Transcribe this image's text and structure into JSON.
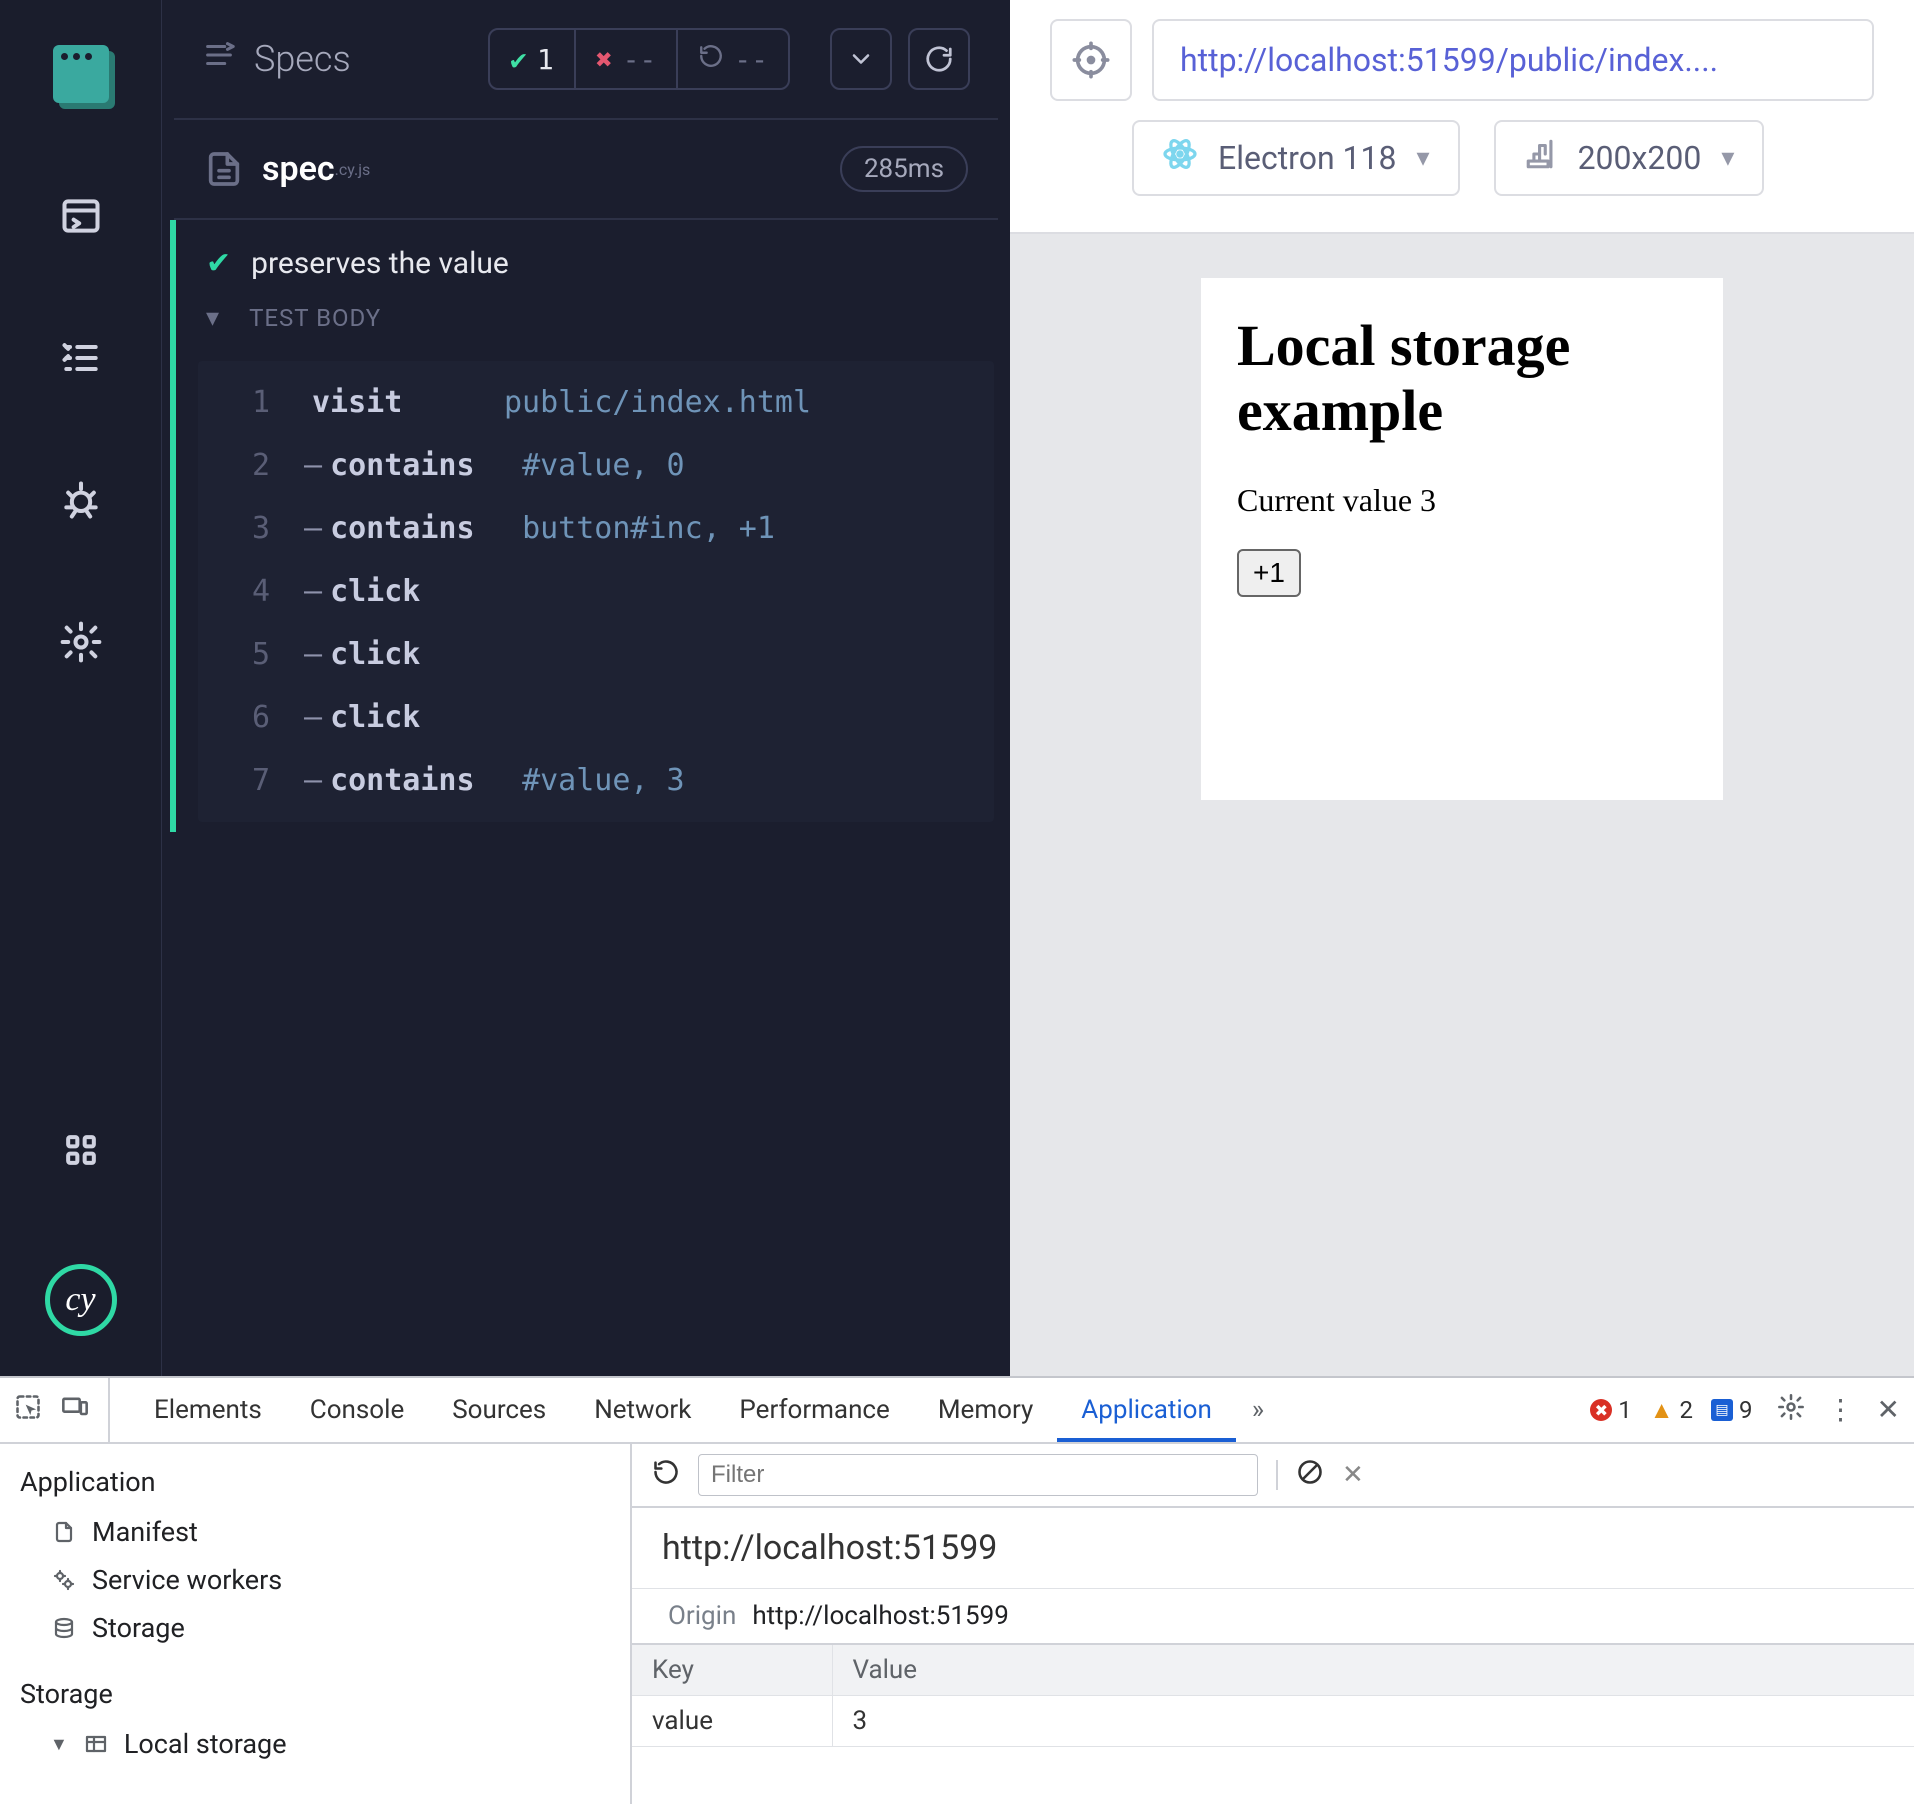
{
  "rail": {},
  "specsHeader": {
    "title": "Specs",
    "pass": "1",
    "fail": "--",
    "pending": "--"
  },
  "specFile": {
    "name": "spec",
    "ext": ".cy.js",
    "time": "285ms"
  },
  "test": {
    "title": "preserves the value",
    "bodyLabel": "TEST BODY",
    "commands": [
      {
        "n": "1",
        "dash": "",
        "cmd": "visit",
        "args": "public/index.html"
      },
      {
        "n": "2",
        "dash": "–",
        "cmd": "contains",
        "args": "#value, 0"
      },
      {
        "n": "3",
        "dash": "–",
        "cmd": "contains",
        "args": "button#inc, +1"
      },
      {
        "n": "4",
        "dash": "–",
        "cmd": "click",
        "args": ""
      },
      {
        "n": "5",
        "dash": "–",
        "cmd": "click",
        "args": ""
      },
      {
        "n": "6",
        "dash": "–",
        "cmd": "click",
        "args": ""
      },
      {
        "n": "7",
        "dash": "–",
        "cmd": "contains",
        "args": "#value, 3"
      }
    ]
  },
  "preview": {
    "url": "http://localhost:51599/public/index....",
    "browser": "Electron 118",
    "viewport": "200x200",
    "app": {
      "h1": "Local storage example",
      "textPrefix": "Current value ",
      "value": "3",
      "button": "+1"
    }
  },
  "devtools": {
    "tabs": [
      "Elements",
      "Console",
      "Sources",
      "Network",
      "Performance",
      "Memory",
      "Application"
    ],
    "activeTab": "Application",
    "counts": {
      "error": "1",
      "warn": "2",
      "info": "9"
    },
    "filterPlaceholder": "Filter",
    "address": "http://localhost:51599",
    "originLabel": "Origin",
    "origin": "http://localhost:51599",
    "leftSections": {
      "appLabel": "Application",
      "appItems": [
        "Manifest",
        "Service workers",
        "Storage"
      ],
      "storageLabel": "Storage",
      "localStorage": "Local storage"
    },
    "table": {
      "headers": [
        "Key",
        "Value"
      ],
      "rows": [
        [
          "value",
          "3"
        ]
      ]
    }
  }
}
